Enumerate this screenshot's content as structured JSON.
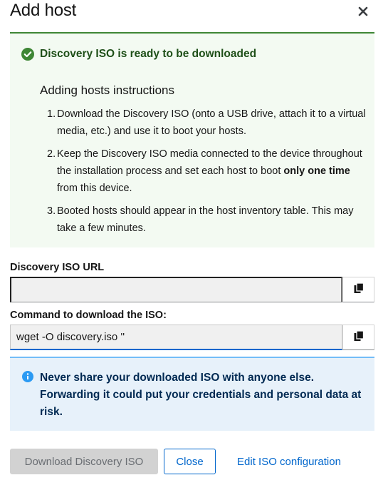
{
  "modal": {
    "title": "Add host",
    "close_icon": "close-icon"
  },
  "success_alert": {
    "icon": "check-circle-icon",
    "title": "Discovery ISO is ready to be downloaded",
    "color": "#3e8635"
  },
  "instructions": {
    "title": "Adding hosts instructions",
    "steps": [
      {
        "num": "1.",
        "text": "Download the Discovery ISO (onto a USB drive, attach it to a virtual media, etc.) and use it to boot your hosts."
      },
      {
        "num": "2.",
        "text_before": "Keep the Discovery ISO media connected to the device throughout the installation process and set each host to boot ",
        "text_bold": "only one time",
        "text_after": " from this device."
      },
      {
        "num": "3.",
        "text": "Booted hosts should appear in the host inventory table. This may take a few minutes."
      }
    ]
  },
  "iso_url": {
    "label": "Discovery ISO URL",
    "value": "",
    "copy_icon": "copy-icon"
  },
  "command": {
    "label": "Command to download the ISO:",
    "value": "wget -O discovery.iso ''",
    "copy_icon": "copy-icon"
  },
  "info_alert": {
    "icon": "info-circle-icon",
    "text": "Never share your downloaded ISO with anyone else. Forwarding it could put your credentials and personal data at risk.",
    "color": "#2b9af3"
  },
  "footer": {
    "download_label": "Download Discovery ISO",
    "close_label": "Close",
    "edit_label": "Edit ISO configuration"
  }
}
